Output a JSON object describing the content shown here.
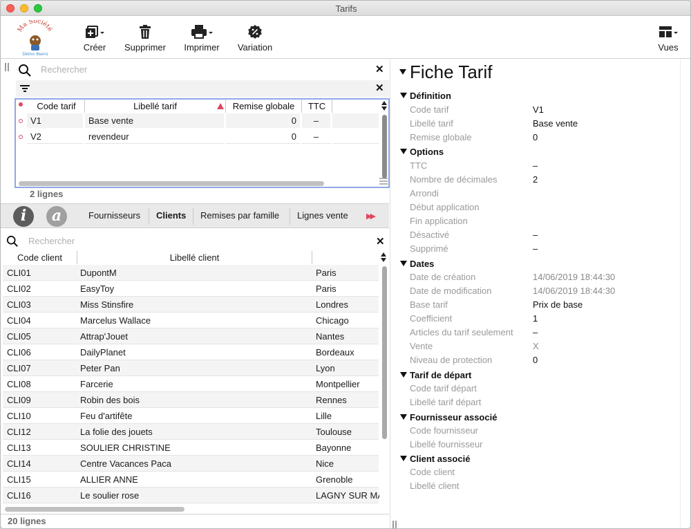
{
  "window": {
    "title": "Tarifs"
  },
  "toolbar": {
    "logo_text_top": "Ma Société",
    "logo_text_bottom": "Démo 8sens",
    "create_label": "Créer",
    "delete_label": "Supprimer",
    "print_label": "Imprimer",
    "variation_label": "Variation",
    "views_label": "Vues"
  },
  "tarif_list": {
    "search_placeholder": "Rechercher",
    "columns": {
      "code": "Code tarif",
      "libelle": "Libellé tarif",
      "remise": "Remise globale",
      "ttc": "TTC"
    },
    "rows": [
      {
        "code": "V1",
        "libelle": "Base vente",
        "remise": "0",
        "ttc": "–"
      },
      {
        "code": "V2",
        "libelle": "revendeur",
        "remise": "0",
        "ttc": "–"
      }
    ],
    "count_label": "2 lignes"
  },
  "tabs": {
    "info_icon_letter": "i",
    "at_icon_letter": "a",
    "items": [
      "Fournisseurs",
      "Clients",
      "Remises par famille",
      "Lignes vente"
    ],
    "active": "Clients",
    "more_glyph": "▶▶"
  },
  "client_list": {
    "search_placeholder": "Rechercher",
    "columns": {
      "code": "Code client",
      "libelle": "Libellé client"
    },
    "rows": [
      {
        "code": "CLI01",
        "libelle": "DupontM",
        "ville": "Paris"
      },
      {
        "code": "CLI02",
        "libelle": "EasyToy",
        "ville": "Paris"
      },
      {
        "code": "CLI03",
        "libelle": "Miss Stinsfire",
        "ville": "Londres"
      },
      {
        "code": "CLI04",
        "libelle": "Marcelus Wallace",
        "ville": "Chicago"
      },
      {
        "code": "CLI05",
        "libelle": "Attrap'Jouet",
        "ville": "Nantes"
      },
      {
        "code": "CLI06",
        "libelle": "DailyPlanet",
        "ville": "Bordeaux"
      },
      {
        "code": "CLI07",
        "libelle": "Peter Pan",
        "ville": "Lyon"
      },
      {
        "code": "CLI08",
        "libelle": "Farcerie",
        "ville": "Montpellier"
      },
      {
        "code": "CLI09",
        "libelle": "Robin des bois",
        "ville": "Rennes"
      },
      {
        "code": "CLI10",
        "libelle": "Feu d'artifête",
        "ville": "Lille"
      },
      {
        "code": "CLI12",
        "libelle": "La folie des jouets",
        "ville": "Toulouse"
      },
      {
        "code": "CLI13",
        "libelle": "SOULIER CHRISTINE",
        "ville": "Bayonne"
      },
      {
        "code": "CLI14",
        "libelle": "Centre Vacances Paca",
        "ville": "Nice"
      },
      {
        "code": "CLI15",
        "libelle": "ALLIER ANNE",
        "ville": "Grenoble"
      },
      {
        "code": "CLI16",
        "libelle": "Le soulier rose",
        "ville": "LAGNY SUR MA"
      }
    ],
    "count_label": "20 lignes"
  },
  "fiche": {
    "title": "Fiche Tarif",
    "sections": {
      "definition": "Définition",
      "options": "Options",
      "dates": "Dates",
      "tarif_depart": "Tarif de départ",
      "fournisseur": "Fournisseur associé",
      "client": "Client associé"
    },
    "fields": {
      "code_tarif": {
        "label": "Code tarif",
        "value": "V1"
      },
      "libelle_tarif": {
        "label": "Libellé tarif",
        "value": "Base vente"
      },
      "remise_globale": {
        "label": "Remise globale",
        "value": "0"
      },
      "ttc": {
        "label": "TTC",
        "value": "–"
      },
      "nb_decimales": {
        "label": "Nombre de décimales",
        "value": "2"
      },
      "arrondi": {
        "label": "Arrondi",
        "value": ""
      },
      "debut_application": {
        "label": "Début application",
        "value": ""
      },
      "fin_application": {
        "label": "Fin application",
        "value": ""
      },
      "desactive": {
        "label": "Désactivé",
        "value": "–"
      },
      "supprime": {
        "label": "Supprimé",
        "value": "–"
      },
      "date_creation": {
        "label": "Date de création",
        "value": "14/06/2019 18:44:30"
      },
      "date_modification": {
        "label": "Date de modification",
        "value": "14/06/2019 18:44:30"
      },
      "base_tarif": {
        "label": "Base tarif",
        "value": "Prix de base"
      },
      "coefficient": {
        "label": "Coefficient",
        "value": "1"
      },
      "articles_seulement": {
        "label": "Articles du tarif seulement",
        "value": "–"
      },
      "vente": {
        "label": "Vente",
        "value": "X"
      },
      "niveau_protection": {
        "label": "Niveau de protection",
        "value": "0"
      },
      "code_tarif_depart": {
        "label": "Code tarif départ",
        "value": ""
      },
      "libelle_tarif_depart": {
        "label": "Libellé tarif départ",
        "value": ""
      },
      "code_fournisseur": {
        "label": "Code fournisseur",
        "value": ""
      },
      "libelle_fournisseur": {
        "label": "Libellé fournisseur",
        "value": ""
      },
      "code_client": {
        "label": "Code client",
        "value": ""
      },
      "libelle_client": {
        "label": "Libellé client",
        "value": ""
      }
    }
  },
  "colors": {
    "accent_border": "#8fa8e6",
    "sort_arrow": "#e0475f",
    "more_arrows": "#e0475f",
    "label_grey": "#9a9a9a"
  }
}
